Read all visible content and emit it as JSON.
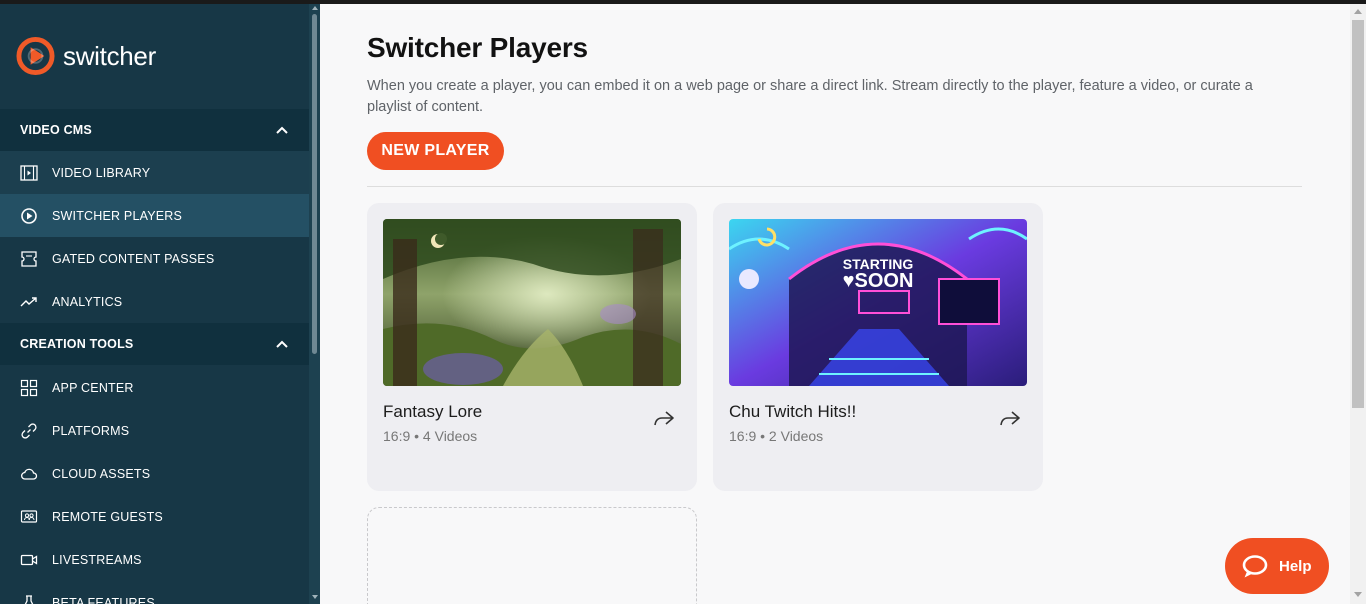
{
  "app": {
    "logo_text": "switcher"
  },
  "sidebar": {
    "sections": [
      {
        "title": "VIDEO CMS",
        "items": [
          {
            "label": "VIDEO LIBRARY",
            "icon": "film-icon"
          },
          {
            "label": "SWITCHER PLAYERS",
            "icon": "player-icon"
          },
          {
            "label": "GATED CONTENT PASSES",
            "icon": "ticket-icon"
          },
          {
            "label": "ANALYTICS",
            "icon": "trend-icon"
          }
        ]
      },
      {
        "title": "CREATION TOOLS",
        "items": [
          {
            "label": "APP CENTER",
            "icon": "grid-icon"
          },
          {
            "label": "PLATFORMS",
            "icon": "link-icon"
          },
          {
            "label": "CLOUD ASSETS",
            "icon": "cloud-icon"
          },
          {
            "label": "REMOTE GUESTS",
            "icon": "remote-guests-icon"
          },
          {
            "label": "LIVESTREAMS",
            "icon": "camera-icon"
          },
          {
            "label": "BETA FEATURES",
            "icon": "beta-icon"
          }
        ]
      }
    ]
  },
  "main": {
    "title": "Switcher Players",
    "description": "When you create a player, you can embed it on a web page or share a direct link. Stream directly to the player, feature a video, or curate a playlist of content.",
    "new_player_label": "NEW PLAYER",
    "players": [
      {
        "name": "Fantasy Lore",
        "meta": "16:9 • 4 Videos"
      },
      {
        "name": "Chu Twitch Hits!!",
        "meta": "16:9 • 2 Videos"
      }
    ]
  },
  "help": {
    "label": "Help"
  },
  "colors": {
    "accent": "#f04f22",
    "sidebar_bg": "#173746",
    "active_item": "#245064"
  }
}
